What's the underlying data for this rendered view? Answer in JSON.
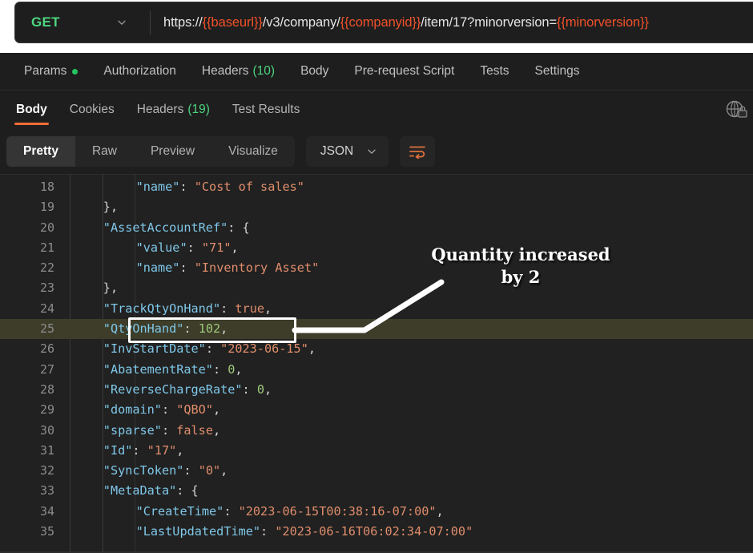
{
  "request": {
    "method": "GET",
    "method_caret_icon": "chevron-down-icon",
    "url_parts": [
      {
        "text": "https://",
        "type": "plain"
      },
      {
        "text": "{{baseurl}}",
        "type": "var"
      },
      {
        "text": "/v3/company/",
        "type": "plain"
      },
      {
        "text": "{{companyid}}",
        "type": "var"
      },
      {
        "text": "/item/17?minorversion=",
        "type": "plain"
      },
      {
        "text": "{{minorversion}}",
        "type": "var"
      }
    ],
    "url_full": "https://{{baseurl}}/v3/company/{{companyid}}/item/17?minorversion={{minorversion}}",
    "tabs": [
      {
        "label": "Params",
        "badge": "",
        "has_dot": true,
        "active": false
      },
      {
        "label": "Authorization",
        "badge": "",
        "has_dot": false,
        "active": false
      },
      {
        "label": "Headers",
        "badge": "(10)",
        "has_dot": false,
        "active": false
      },
      {
        "label": "Body",
        "badge": "",
        "has_dot": false,
        "active": false
      },
      {
        "label": "Pre-request Script",
        "badge": "",
        "has_dot": false,
        "active": false
      },
      {
        "label": "Tests",
        "badge": "",
        "has_dot": false,
        "active": false
      },
      {
        "label": "Settings",
        "badge": "",
        "has_dot": false,
        "active": false
      }
    ]
  },
  "response": {
    "tabs": [
      {
        "label": "Body",
        "badge": "",
        "active": true
      },
      {
        "label": "Cookies",
        "badge": "",
        "active": false
      },
      {
        "label": "Headers",
        "badge": "(19)",
        "active": false
      },
      {
        "label": "Test Results",
        "badge": "",
        "active": false
      }
    ],
    "globe_icon": "globe-lock-icon",
    "format_tabs": [
      {
        "label": "Pretty",
        "active": true
      },
      {
        "label": "Raw",
        "active": false
      },
      {
        "label": "Preview",
        "active": false
      },
      {
        "label": "Visualize",
        "active": false
      }
    ],
    "language_select": {
      "value": "JSON",
      "caret_icon": "chevron-down-icon"
    },
    "wrap_button": {
      "icon": "word-wrap-icon"
    }
  },
  "colors": {
    "accent_orange": "#ef6c33",
    "method_green": "#4ed47f",
    "count_green": "#4ed47f",
    "variable_red": "#f0522a",
    "json_key": "#7fc7e8",
    "json_string": "#e08d6b",
    "json_number": "#9fc97a",
    "highlight_row": "#3d3d2a",
    "editor_bg": "#212121",
    "panel_bg": "#1e1e1e"
  },
  "code": {
    "lines": [
      {
        "num": "18",
        "indent": 8,
        "tokens": [
          {
            "t": "\"name\"",
            "c": "k"
          },
          {
            "t": ": ",
            "c": "p"
          },
          {
            "t": "\"Cost of sales\"",
            "c": "s"
          }
        ],
        "highlight": false
      },
      {
        "num": "19",
        "indent": 4,
        "tokens": [
          {
            "t": "},",
            "c": "p"
          }
        ],
        "highlight": false
      },
      {
        "num": "20",
        "indent": 4,
        "tokens": [
          {
            "t": "\"AssetAccountRef\"",
            "c": "k"
          },
          {
            "t": ": {",
            "c": "p"
          }
        ],
        "highlight": false
      },
      {
        "num": "21",
        "indent": 8,
        "tokens": [
          {
            "t": "\"value\"",
            "c": "k"
          },
          {
            "t": ": ",
            "c": "p"
          },
          {
            "t": "\"71\"",
            "c": "s"
          },
          {
            "t": ",",
            "c": "p"
          }
        ],
        "highlight": false
      },
      {
        "num": "22",
        "indent": 8,
        "tokens": [
          {
            "t": "\"name\"",
            "c": "k"
          },
          {
            "t": ": ",
            "c": "p"
          },
          {
            "t": "\"Inventory Asset\"",
            "c": "s"
          }
        ],
        "highlight": false
      },
      {
        "num": "23",
        "indent": 4,
        "tokens": [
          {
            "t": "},",
            "c": "p"
          }
        ],
        "highlight": false
      },
      {
        "num": "24",
        "indent": 4,
        "tokens": [
          {
            "t": "\"TrackQtyOnHand\"",
            "c": "k"
          },
          {
            "t": ": ",
            "c": "p"
          },
          {
            "t": "true",
            "c": "b"
          },
          {
            "t": ",",
            "c": "p"
          }
        ],
        "highlight": false
      },
      {
        "num": "25",
        "indent": 4,
        "tokens": [
          {
            "t": "\"QtyOnHand\"",
            "c": "k"
          },
          {
            "t": ": ",
            "c": "p"
          },
          {
            "t": "102",
            "c": "n"
          },
          {
            "t": ",",
            "c": "p"
          }
        ],
        "highlight": true
      },
      {
        "num": "26",
        "indent": 4,
        "tokens": [
          {
            "t": "\"InvStartDate\"",
            "c": "k"
          },
          {
            "t": ": ",
            "c": "p"
          },
          {
            "t": "\"2023-06-15\"",
            "c": "s"
          },
          {
            "t": ",",
            "c": "p"
          }
        ],
        "highlight": false
      },
      {
        "num": "27",
        "indent": 4,
        "tokens": [
          {
            "t": "\"AbatementRate\"",
            "c": "k"
          },
          {
            "t": ": ",
            "c": "p"
          },
          {
            "t": "0",
            "c": "n"
          },
          {
            "t": ",",
            "c": "p"
          }
        ],
        "highlight": false
      },
      {
        "num": "28",
        "indent": 4,
        "tokens": [
          {
            "t": "\"ReverseChargeRate\"",
            "c": "k"
          },
          {
            "t": ": ",
            "c": "p"
          },
          {
            "t": "0",
            "c": "n"
          },
          {
            "t": ",",
            "c": "p"
          }
        ],
        "highlight": false
      },
      {
        "num": "29",
        "indent": 4,
        "tokens": [
          {
            "t": "\"domain\"",
            "c": "k"
          },
          {
            "t": ": ",
            "c": "p"
          },
          {
            "t": "\"QBO\"",
            "c": "s"
          },
          {
            "t": ",",
            "c": "p"
          }
        ],
        "highlight": false
      },
      {
        "num": "30",
        "indent": 4,
        "tokens": [
          {
            "t": "\"sparse\"",
            "c": "k"
          },
          {
            "t": ": ",
            "c": "p"
          },
          {
            "t": "false",
            "c": "b"
          },
          {
            "t": ",",
            "c": "p"
          }
        ],
        "highlight": false
      },
      {
        "num": "31",
        "indent": 4,
        "tokens": [
          {
            "t": "\"Id\"",
            "c": "k"
          },
          {
            "t": ": ",
            "c": "p"
          },
          {
            "t": "\"17\"",
            "c": "s"
          },
          {
            "t": ",",
            "c": "p"
          }
        ],
        "highlight": false
      },
      {
        "num": "32",
        "indent": 4,
        "tokens": [
          {
            "t": "\"SyncToken\"",
            "c": "k"
          },
          {
            "t": ": ",
            "c": "p"
          },
          {
            "t": "\"0\"",
            "c": "s"
          },
          {
            "t": ",",
            "c": "p"
          }
        ],
        "highlight": false
      },
      {
        "num": "33",
        "indent": 4,
        "tokens": [
          {
            "t": "\"MetaData\"",
            "c": "k"
          },
          {
            "t": ": {",
            "c": "p"
          }
        ],
        "highlight": false
      },
      {
        "num": "34",
        "indent": 8,
        "tokens": [
          {
            "t": "\"CreateTime\"",
            "c": "k"
          },
          {
            "t": ": ",
            "c": "p"
          },
          {
            "t": "\"2023-06-15T00:38:16-07:00\"",
            "c": "s"
          },
          {
            "t": ",",
            "c": "p"
          }
        ],
        "highlight": false
      },
      {
        "num": "35",
        "indent": 8,
        "tokens": [
          {
            "t": "\"LastUpdatedTime\"",
            "c": "k"
          },
          {
            "t": ": ",
            "c": "p"
          },
          {
            "t": "\"2023-06-16T06:02:34-07:00\"",
            "c": "s"
          }
        ],
        "highlight": false
      }
    ]
  },
  "annotation": {
    "line1": "Quantity increased",
    "line2": "by 2",
    "text": "Quantity increased by 2"
  }
}
